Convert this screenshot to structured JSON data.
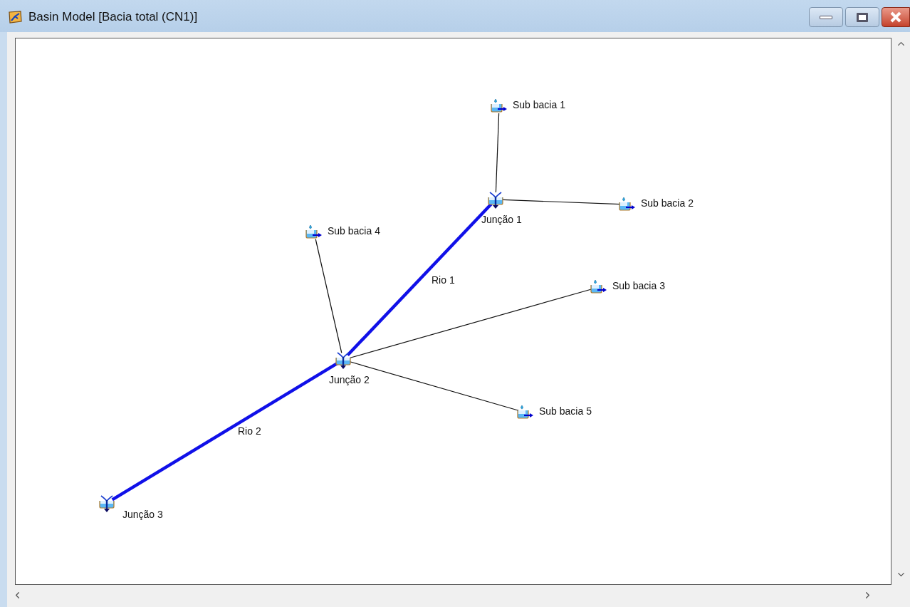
{
  "window": {
    "title": "Basin Model [Bacia total (CN1)]"
  },
  "nodes": [
    {
      "name": "Sub bacia 1",
      "kind": "subbasin"
    },
    {
      "name": "Sub bacia 2",
      "kind": "subbasin"
    },
    {
      "name": "Sub bacia 3",
      "kind": "subbasin"
    },
    {
      "name": "Sub bacia 4",
      "kind": "subbasin"
    },
    {
      "name": "Sub bacia 5",
      "kind": "subbasin"
    },
    {
      "name": "Junção 1",
      "kind": "junction"
    },
    {
      "name": "Junção 2",
      "kind": "junction"
    },
    {
      "name": "Junção 3",
      "kind": "junction"
    }
  ],
  "reaches": [
    {
      "name": "Rio 1"
    },
    {
      "name": "Rio 2"
    }
  ]
}
